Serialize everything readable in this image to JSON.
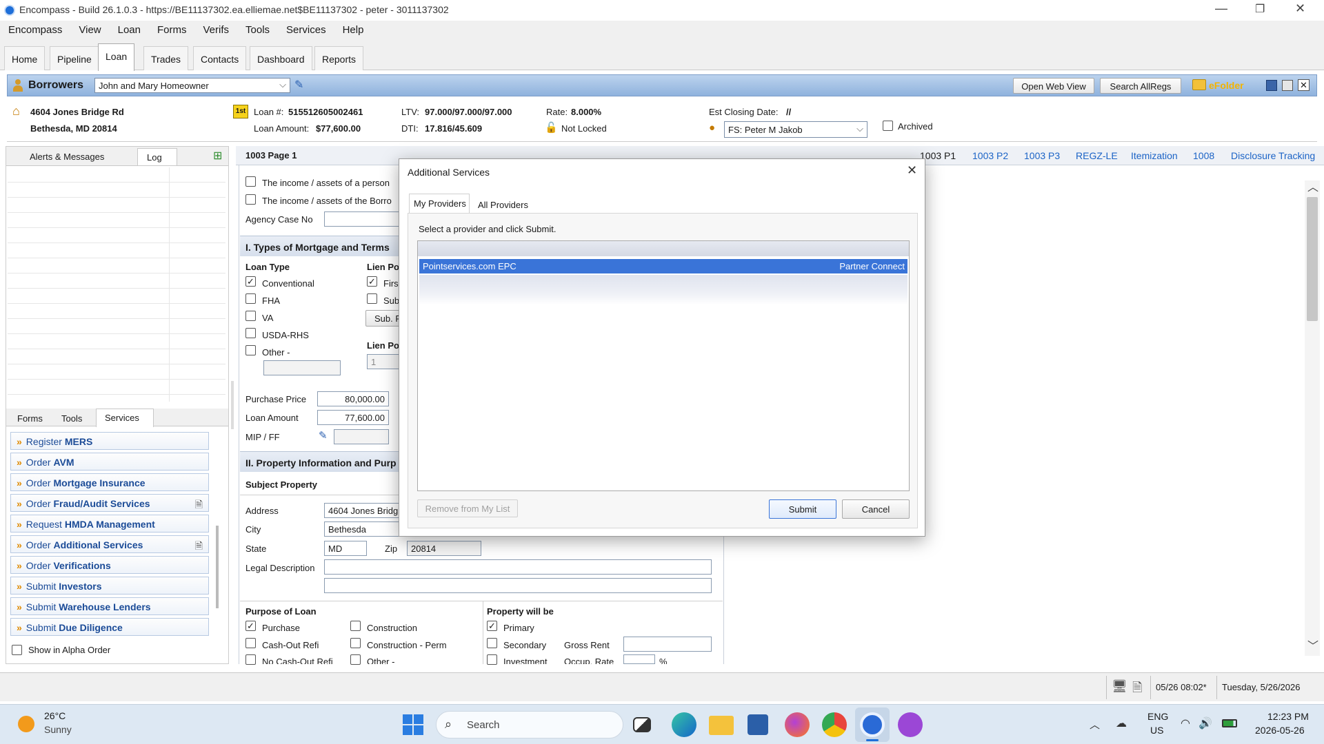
{
  "window": {
    "title": "Encompass - Build 26.1.0.3 - https://BE11137302.ea.elliemae.net$BE11137302 - peter - 3011137302"
  },
  "menu": [
    "Encompass",
    "View",
    "Loan",
    "Forms",
    "Verifs",
    "Tools",
    "Services",
    "Help"
  ],
  "main_tabs": [
    "Home",
    "Pipeline",
    "Loan",
    "Trades",
    "Contacts",
    "Dashboard",
    "Reports"
  ],
  "borrowers": {
    "label": "Borrowers",
    "selected": "John and Mary Homeowner",
    "open_web_view": "Open Web View",
    "search_allregs": "Search AllRegs",
    "efolder": "eFolder"
  },
  "loan": {
    "address1": "4604 Jones Bridge Rd",
    "address2": "Bethesda, MD 20814",
    "lien_badge": "1st",
    "loan_no_label": "Loan #:",
    "loan_no": "515512605002461",
    "amount_label": "Loan Amount:",
    "amount": "$77,600.00",
    "ltv_label": "LTV:",
    "ltv": "97.000/97.000/97.000",
    "dti_label": "DTI:",
    "dti": "17.816/45.609",
    "rate_label": "Rate:",
    "rate": "8.000%",
    "lock_status": "Not Locked",
    "closing_label": "Est Closing Date:",
    "closing": "//",
    "fs": "FS: Peter M Jakob",
    "archived": "Archived"
  },
  "left": {
    "tabs": [
      "Alerts & Messages",
      "Log"
    ],
    "bottom_tabs": [
      "Forms",
      "Tools",
      "Services"
    ],
    "services": [
      {
        "pre": "Register",
        "bold": "MERS"
      },
      {
        "pre": "Order",
        "bold": "AVM"
      },
      {
        "pre": "Order",
        "bold": "Mortgage Insurance"
      },
      {
        "pre": "Order",
        "bold": "Fraud/Audit Services"
      },
      {
        "pre": "Request",
        "bold": "HMDA Management"
      },
      {
        "pre": "Order",
        "bold": "Additional Services"
      },
      {
        "pre": "Order",
        "bold": "Verifications"
      },
      {
        "pre": "Submit",
        "bold": "Investors"
      },
      {
        "pre": "Submit",
        "bold": "Warehouse Lenders"
      },
      {
        "pre": "Submit",
        "bold": "Due Diligence"
      }
    ],
    "alpha": "Show in Alpha Order"
  },
  "form": {
    "title": "1003 Page 1",
    "links": [
      "1003 P1",
      "1003 P2",
      "1003 P3",
      "REGZ-LE",
      "Itemization",
      "1008",
      "Disclosure Tracking"
    ],
    "income1": "The income / assets of a person",
    "income2": "The income / assets of the Borro",
    "agency_case": "Agency Case No",
    "sec1": "I. Types of Mortgage and Terms",
    "loan_type": "Loan Type",
    "lt_options": [
      "Conventional",
      "FHA",
      "VA",
      "USDA-RHS",
      "Other -"
    ],
    "lien_pos": "Lien Po",
    "lien_first": "Firs",
    "lien_sub": "Sub",
    "sub_btn": "Sub. F",
    "lien_pos2": "Lien Po",
    "lien_val": "1",
    "purchase_price_label": "Purchase Price",
    "purchase_price": "80,000.00",
    "loan_amount_label": "Loan Amount",
    "loan_amount": "77,600.00",
    "mip_label": "MIP / FF",
    "sec2": "II. Property Information and Purp",
    "subject": "Subject Property",
    "address_label": "Address",
    "address": "4604 Jones Bridg",
    "city_label": "City",
    "city": "Bethesda",
    "state_label": "State",
    "state": "MD",
    "zip_label": "Zip",
    "zip": "20814",
    "legal_label": "Legal Description",
    "purpose_label": "Purpose of Loan",
    "purpose": [
      "Purchase",
      "Cash-Out Refi",
      "No Cash-Out Refi"
    ],
    "purpose2": [
      "Construction",
      "Construction - Perm",
      "Other -"
    ],
    "propwill_label": "Property will be",
    "propwill": [
      "Primary",
      "Secondary",
      "Investment"
    ],
    "gross_rent": "Gross Rent",
    "occup_rate": "Occup. Rate",
    "pct": "%"
  },
  "dialog": {
    "title": "Additional Services",
    "tabs": [
      "My Providers",
      "All Providers"
    ],
    "instruction": "Select a provider and click Submit.",
    "providers": [
      {
        "name": "Pointservices.com EPC",
        "type": "Partner Connect"
      }
    ],
    "remove": "Remove from My List",
    "submit": "Submit",
    "cancel": "Cancel"
  },
  "status": {
    "time": "05/26 08:02*",
    "date": "Tuesday, 5/26/2026"
  },
  "taskbar": {
    "temp": "26°C",
    "weather": "Sunny",
    "search": "Search",
    "lang1": "ENG",
    "lang2": "US",
    "clock": "12:23 PM",
    "date": "2026-05-26"
  }
}
